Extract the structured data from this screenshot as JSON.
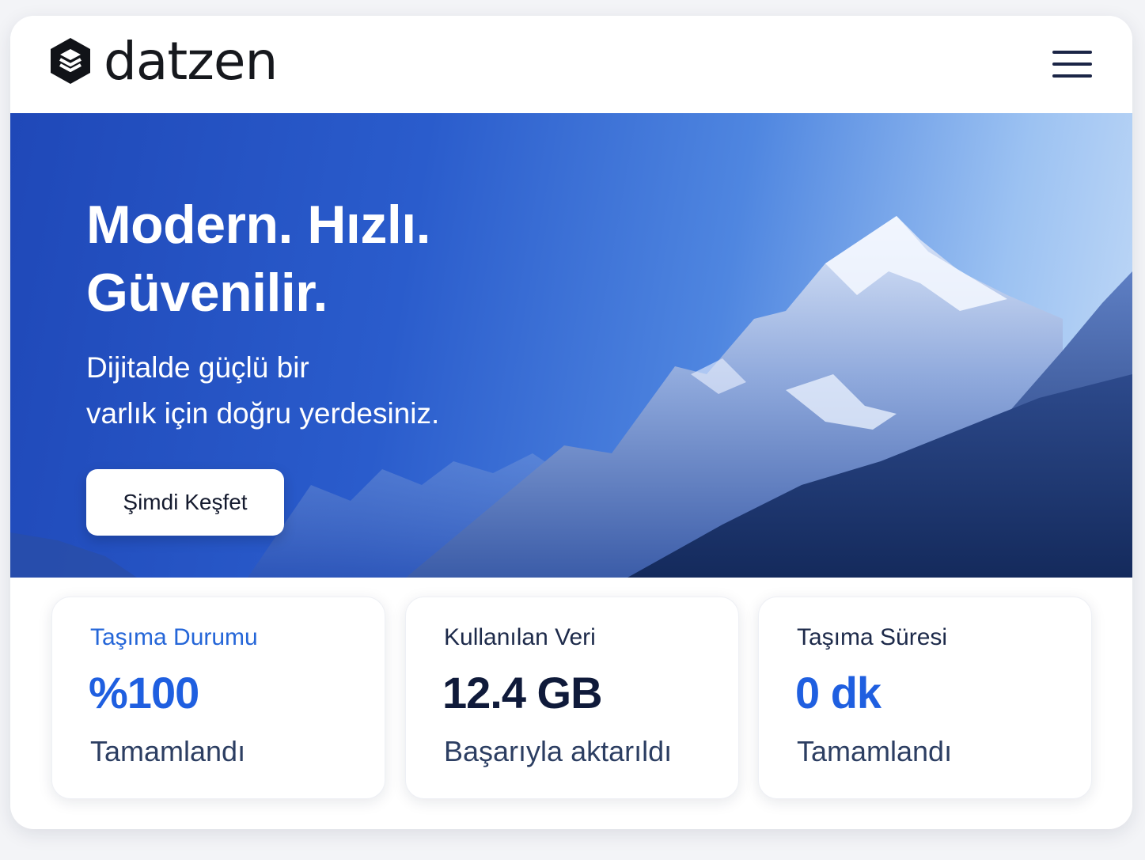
{
  "header": {
    "brand_name": "datzen",
    "logo_icon": "layers-hexagon-icon",
    "menu_icon": "hamburger-menu-icon"
  },
  "hero": {
    "title_line1": "Modern. Hızlı.",
    "title_line2": "Güvenilir.",
    "subtitle_line1": "Dijitalde güçlü bir",
    "subtitle_line2": "varlık için doğru yerdesiniz.",
    "cta_label": "Şimdi Keşfet",
    "background_image": "snowy-mountain-landscape",
    "gradient_colors": [
      "#1f48b8",
      "#4f86e0",
      "#c4dbf7"
    ]
  },
  "stats": [
    {
      "label": "Taşıma Durumu",
      "value": "%100",
      "note": "Tamamlandı",
      "progress_fraction": 1.0
    },
    {
      "label": "Kullanılan Veri",
      "value": "12.4 GB",
      "note": "Başarıyla aktarıldı"
    },
    {
      "label": "Taşıma Süresi",
      "value": "0 dk",
      "note": "Tamamlandı"
    }
  ],
  "colors": {
    "accent": "#1f5fe0",
    "dark_text": "#0f1a3a",
    "card_bg": "#ffffff"
  }
}
